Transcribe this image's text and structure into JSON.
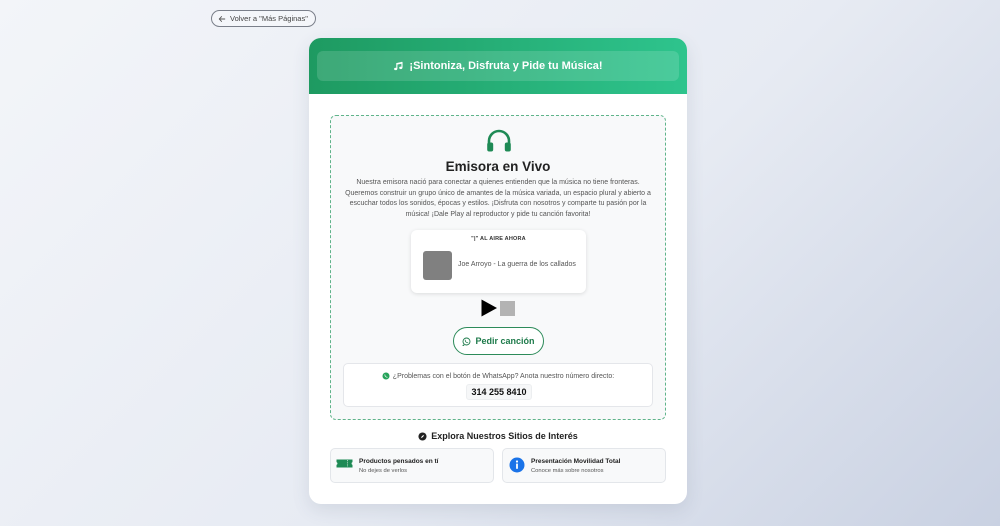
{
  "nav": {
    "back_label": "Volver a \"Más Páginas\""
  },
  "header": {
    "title": "¡Sintoniza, Disfruta y Pide tu Música!"
  },
  "station": {
    "title": "Emisora en Vivo",
    "description": "Nuestra emisora nació para conectar a quienes entienden que la música no tiene fronteras. Queremos construir un grupo único de amantes de la música variada, un espacio plural y abierto a escuchar todos los sonidos, épocas y estilos. ¡Disfruta con nosotros y comparte tu pasión por la música! ¡Dale Play al reproductor y pide tu canción favorita!",
    "now_playing_label": "\"|\" AL AIRE AHORA",
    "now_playing_track": "Joe Arroyo - La guerra de los callados",
    "request_label": "Pedir canción",
    "whatsapp_help": "¿Problemas con el botón de WhatsApp? Anota nuestro número directo:",
    "phone": "314 255 8410"
  },
  "explore": {
    "title": "Explora Nuestros Sitios de Interés",
    "sites": [
      {
        "title": "Productos pensados en tí",
        "subtitle": "No dejes de verlos",
        "icon": "ticket-icon"
      },
      {
        "title": "Presentación Movilidad Total",
        "subtitle": "Conoce más sobre nosotros",
        "icon": "info-icon"
      }
    ]
  },
  "colors": {
    "brand_green": "#1e9a61",
    "brand_green_light": "#2ec48d",
    "accent_green": "#1d7a4a",
    "info_blue": "#1a73e8"
  }
}
